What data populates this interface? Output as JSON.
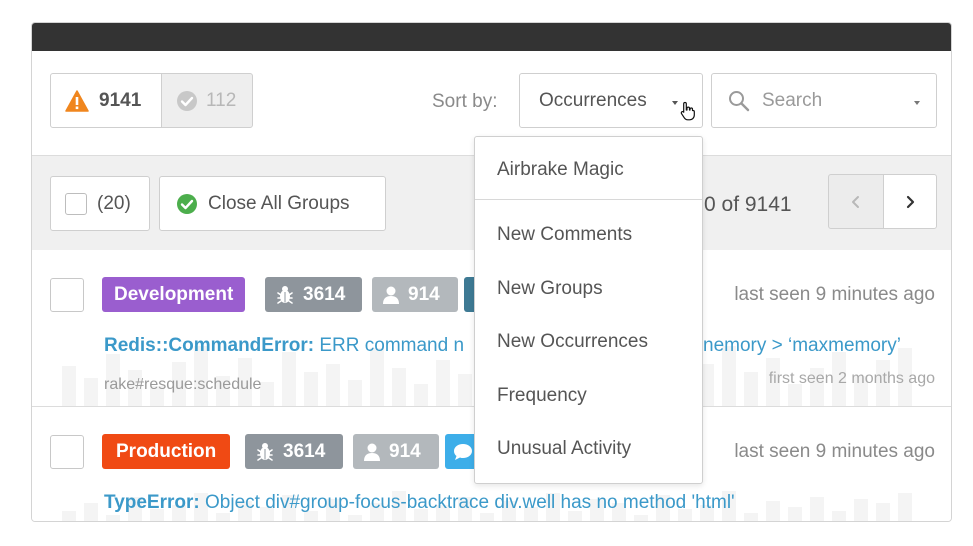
{
  "counters": {
    "open": "9141",
    "resolved": "112"
  },
  "toolbar": {
    "sort_label": "Sort by:",
    "sort_value": "Occurrences",
    "search_placeholder": "Search"
  },
  "actions": {
    "selected_count": "(20)",
    "close_all_label": "Close All Groups"
  },
  "pager": {
    "text": "0 of 9141"
  },
  "sort_menu": {
    "items": [
      "Airbrake Magic",
      "New Comments",
      "New Groups",
      "New Occurrences",
      "Frequency",
      "Unusual Activity"
    ]
  },
  "groups": [
    {
      "environment": "Development",
      "occurrences": "3614",
      "users": "914",
      "last_seen": "last seen 9 minutes ago",
      "error_type": "Redis::CommandError:",
      "message_start": " ERR command n",
      "message_end": "nemory > ‘maxmemory’",
      "component": "rake#resque:schedule",
      "first_seen": "first seen 2 months ago"
    },
    {
      "environment": "Production",
      "occurrences": "3614",
      "users": "914",
      "last_seen": "last seen 9 minutes ago",
      "error_type": "TypeError:",
      "message": " Object div#group-focus-backtrace div.well has no method 'html'"
    }
  ],
  "colors": {
    "env_development": "#9a5ecf",
    "env_production": "#f04a14",
    "link": "#3b99c9",
    "warning": "#f0861e",
    "success": "#4cae4c"
  }
}
